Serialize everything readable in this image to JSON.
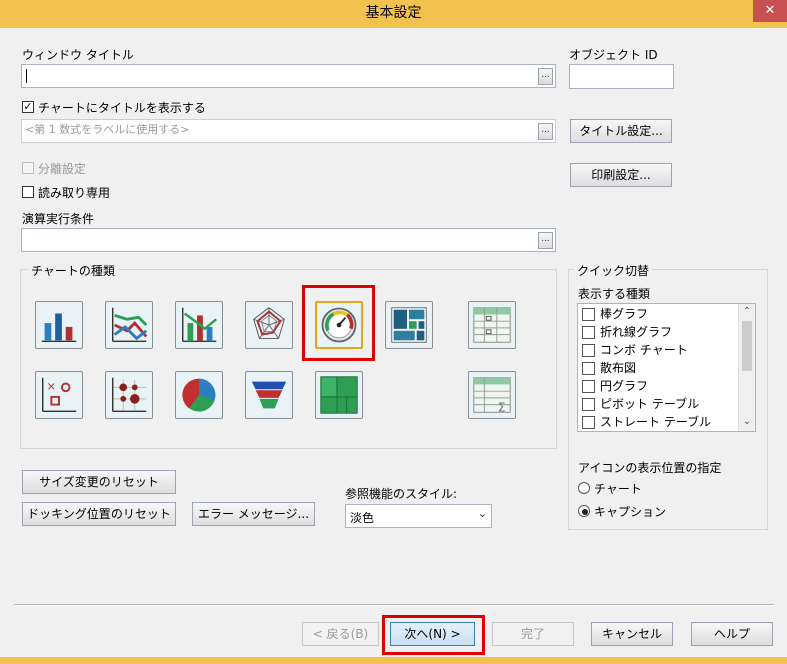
{
  "window": {
    "title": "基本設定",
    "close": "✕"
  },
  "window_title": {
    "label": "ウィンドウ タイトル",
    "value": "",
    "browse": "..."
  },
  "object_id": {
    "label": "オブジェクト ID",
    "value": ""
  },
  "show_title": {
    "label": "チャートにタイトルを表示する",
    "checked": true
  },
  "title_field": {
    "placeholder": "<第 1 数式をラベルに使用する>",
    "browse": "..."
  },
  "buttons": {
    "title_settings": "タイトル設定...",
    "print_settings": "印刷設定...",
    "reset_size": "サイズ変更のリセット",
    "reset_docking": "ドッキング位置のリセット",
    "error_message": "エラー メッセージ...",
    "back": "< 戻る(B)",
    "next": "次へ(N) >",
    "finish": "完了",
    "cancel": "キャンセル",
    "help": "ヘルプ"
  },
  "detach": {
    "label": "分離設定"
  },
  "read_only": {
    "label": "読み取り専用"
  },
  "calc_condition": {
    "label": "演算実行条件",
    "value": "",
    "browse": "..."
  },
  "chart_types": {
    "label": "チャートの種類",
    "icons": [
      "bar-chart",
      "line-chart",
      "combo-chart",
      "radar-chart",
      "gauge-chart",
      "block-chart",
      "pivot-table",
      "scatter-chart",
      "grid-chart",
      "pie-chart",
      "funnel-chart",
      "treemap-chart",
      "straight-table"
    ]
  },
  "quick_change": {
    "label": "クイック切替",
    "types_label": "表示する種類",
    "types": [
      "棒グラフ",
      "折れ線グラフ",
      "コンボ チャート",
      "散布図",
      "円グラフ",
      "ピボット テーブル",
      "ストレート テーブル"
    ],
    "position_label": "アイコンの表示位置の指定",
    "options": [
      "チャート",
      "キャプション"
    ],
    "selected": "キャプション"
  },
  "lookup_style": {
    "label": "参照機能のスタイル:",
    "value": "淡色",
    "arrow": "⌄"
  },
  "scroll": {
    "up": "⌃",
    "down": "⌄"
  },
  "colors": {
    "titlebar": "#f2c24f",
    "highlight": "#e00000",
    "accent_green": "#2e9e55"
  }
}
